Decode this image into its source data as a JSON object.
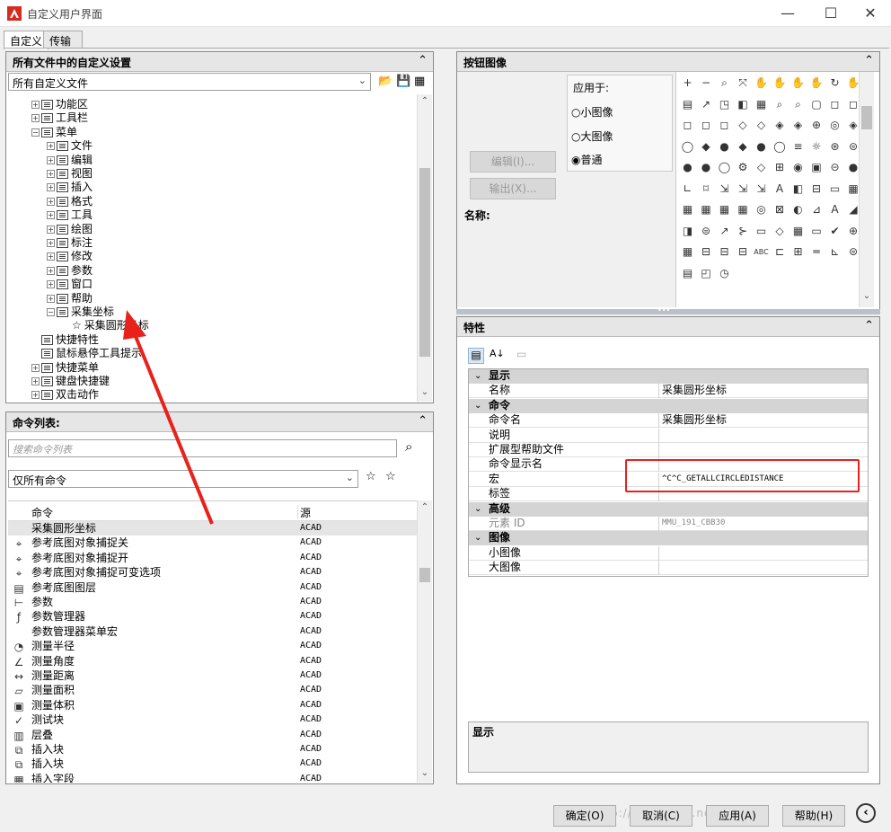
{
  "window": {
    "title": "自定义用户界面",
    "min": "—",
    "max": "☐",
    "close": "✕"
  },
  "tabs": [
    "自定义",
    "传输"
  ],
  "custom_panel": {
    "header": "所有文件中的自定义设置",
    "combo_value": "所有自定义文件",
    "tree": [
      {
        "label": "功能区",
        "indent": 0,
        "exp": "+"
      },
      {
        "label": "工具栏",
        "indent": 0,
        "exp": "+"
      },
      {
        "label": "菜单",
        "indent": 0,
        "exp": "−"
      },
      {
        "label": "文件",
        "indent": 1,
        "exp": "+"
      },
      {
        "label": "编辑",
        "indent": 1,
        "exp": "+"
      },
      {
        "label": "视图",
        "indent": 1,
        "exp": "+"
      },
      {
        "label": "插入",
        "indent": 1,
        "exp": "+"
      },
      {
        "label": "格式",
        "indent": 1,
        "exp": "+"
      },
      {
        "label": "工具",
        "indent": 1,
        "exp": "+"
      },
      {
        "label": "绘图",
        "indent": 1,
        "exp": "+"
      },
      {
        "label": "标注",
        "indent": 1,
        "exp": "+"
      },
      {
        "label": "修改",
        "indent": 1,
        "exp": "+"
      },
      {
        "label": "参数",
        "indent": 1,
        "exp": "+"
      },
      {
        "label": "窗口",
        "indent": 1,
        "exp": "+"
      },
      {
        "label": "帮助",
        "indent": 1,
        "exp": "+"
      },
      {
        "label": "采集坐标",
        "indent": 1,
        "exp": "−"
      },
      {
        "label": "采集圆形坐标",
        "indent": 2,
        "exp": ""
      },
      {
        "label": "快捷特性",
        "indent": 0,
        "exp": ""
      },
      {
        "label": "鼠标悬停工具提示",
        "indent": 0,
        "exp": ""
      },
      {
        "label": "快捷菜单",
        "indent": 0,
        "exp": "+"
      },
      {
        "label": "键盘快捷键",
        "indent": 0,
        "exp": "+"
      },
      {
        "label": "双击动作",
        "indent": 0,
        "exp": "+"
      }
    ]
  },
  "command_panel": {
    "header": "命令列表:",
    "search_placeholder": "搜索命令列表",
    "filter_value": "仅所有命令",
    "col_command": "命令",
    "col_source": "源",
    "rows": [
      {
        "icon": "",
        "name": "采集圆形坐标",
        "source": "ACAD"
      },
      {
        "icon": "⌖",
        "name": "参考底图对象捕捉关",
        "source": "ACAD"
      },
      {
        "icon": "⌖",
        "name": "参考底图对象捕捉开",
        "source": "ACAD"
      },
      {
        "icon": "⌖",
        "name": "参考底图对象捕捉可变选项",
        "source": "ACAD"
      },
      {
        "icon": "▤",
        "name": "参考底图图层",
        "source": "ACAD"
      },
      {
        "icon": "⊢",
        "name": "参数",
        "source": "ACAD"
      },
      {
        "icon": "ƒ",
        "name": "参数管理器",
        "source": "ACAD"
      },
      {
        "icon": "",
        "name": "参数管理器菜单宏",
        "source": "ACAD"
      },
      {
        "icon": "◔",
        "name": "测量半径",
        "source": "ACAD"
      },
      {
        "icon": "∠",
        "name": "测量角度",
        "source": "ACAD"
      },
      {
        "icon": "↔",
        "name": "测量距离",
        "source": "ACAD"
      },
      {
        "icon": "▱",
        "name": "测量面积",
        "source": "ACAD"
      },
      {
        "icon": "▣",
        "name": "测量体积",
        "source": "ACAD"
      },
      {
        "icon": "✓",
        "name": "测试块",
        "source": "ACAD"
      },
      {
        "icon": "▥",
        "name": "层叠",
        "source": "ACAD"
      },
      {
        "icon": "⧉",
        "name": "插入块",
        "source": "ACAD"
      },
      {
        "icon": "⧉",
        "name": "插入块",
        "source": "ACAD"
      },
      {
        "icon": "▦",
        "name": "插入字段",
        "source": "ACAD"
      }
    ]
  },
  "button_image_panel": {
    "header": "按钮图像",
    "apply_label": "应用于:",
    "options": [
      "小图像",
      "大图像",
      "普通"
    ],
    "selected": "普通",
    "edit_button": "编辑(I)...",
    "export_button": "输出(X)...",
    "name_label": "名称:",
    "icons": [
      "+",
      "−",
      "⌕",
      "⤧",
      "✋",
      "✋",
      "✋",
      "✋",
      "↻",
      "✋",
      "▤",
      "↗",
      "◳",
      "◧",
      "▦",
      "⌕",
      "⌕",
      "▢",
      "◻",
      "◻",
      "◻",
      "◻",
      "◻",
      "◇",
      "◇",
      "◈",
      "◈",
      "⊕",
      "◎",
      "◈",
      "◯",
      "◆",
      "●",
      "◆",
      "●",
      "◯",
      "≡",
      "☼",
      "⊛",
      "⊜",
      "●",
      "●",
      "◯",
      "⚙",
      "◇",
      "⊞",
      "◉",
      "▣",
      "⊝",
      "●",
      "∟",
      "⌑",
      "⇲",
      "⇲",
      "⇲",
      "A",
      "◧",
      "⊟",
      "▭",
      "▦",
      "▦",
      "▦",
      "▦",
      "▦",
      "◎",
      "⊠",
      "◐",
      "⊿",
      "A",
      "◢",
      "◨",
      "⊜",
      "↗",
      "⊱",
      "▭",
      "◇",
      "▦",
      "▭",
      "✔",
      "⊕",
      "▦",
      "⊟",
      "⊟",
      "⊟",
      "ABC",
      "⊏",
      "⊞",
      "═",
      "⊾",
      "⊜",
      "▤",
      "◰",
      "◷"
    ]
  },
  "properties_panel": {
    "header": "特性",
    "categories": [
      {
        "label": "显示",
        "rows": [
          {
            "name": "名称",
            "value": "采集圆形坐标"
          }
        ]
      },
      {
        "label": "命令",
        "rows": [
          {
            "name": "命令名",
            "value": "采集圆形坐标"
          },
          {
            "name": "说明",
            "value": ""
          },
          {
            "name": "扩展型帮助文件",
            "value": ""
          },
          {
            "name": "命令显示名",
            "value": ""
          },
          {
            "name": "宏",
            "value": "^C^C_GETALLCIRCLEDISTANCE"
          },
          {
            "name": "标签",
            "value": ""
          }
        ]
      },
      {
        "label": "高级",
        "rows": [
          {
            "name": "元素 ID",
            "value": "MMU_191_CBB30"
          }
        ]
      },
      {
        "label": "图像",
        "rows": [
          {
            "name": "小图像",
            "value": ""
          },
          {
            "name": "大图像",
            "value": ""
          }
        ]
      }
    ],
    "description_title": "显示",
    "highlight_color": "#e8221b"
  },
  "footer": {
    "ok": "确定(O)",
    "cancel": "取消(C)",
    "apply": "应用(A)",
    "help": "帮助(H)",
    "watermark": "http://blog.csdn.net/jiwuxi"
  },
  "annotation": {
    "arrow_color": "#e8221b"
  }
}
